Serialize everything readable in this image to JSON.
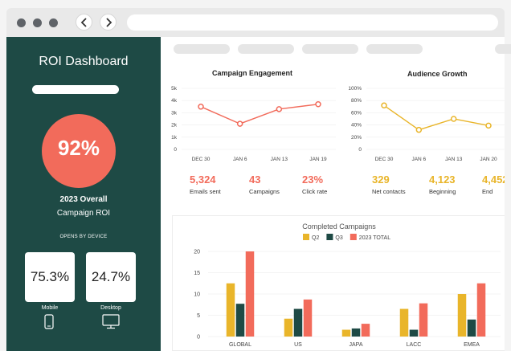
{
  "sidebar": {
    "title": "ROI Dashboard",
    "roi_value": "92%",
    "overall_label": "2023 Overall",
    "campaign_label": "Campaign ROI",
    "opens_label": "OPENS BY DEVICE",
    "devices": [
      {
        "value": "75.3%",
        "label": "Mobile",
        "icon": "mobile-icon"
      },
      {
        "value": "24.7%",
        "label": "Desktop",
        "icon": "desktop-icon"
      }
    ],
    "accent": "#f26b5b",
    "background": "#1e4a45"
  },
  "engagement": {
    "title": "Campaign Engagement",
    "kpis": [
      {
        "value": "5,324",
        "label": "Emails sent"
      },
      {
        "value": "43",
        "label": "Campaigns"
      },
      {
        "value": "23%",
        "label": "Click rate"
      }
    ],
    "color": "#f26b5b"
  },
  "audience": {
    "title": "Audience Growth",
    "kpis": [
      {
        "value": "329",
        "label": "Net contacts"
      },
      {
        "value": "4,123",
        "label": "Beginning"
      },
      {
        "value": "4,452",
        "label": "End"
      }
    ],
    "color": "#e9b52a"
  },
  "completed": {
    "title": "Completed Campaigns"
  },
  "chart_data": [
    {
      "type": "line",
      "title": "Campaign Engagement",
      "x": [
        "DEC 30",
        "JAN 6",
        "JAN 13",
        "JAN 19"
      ],
      "y_ticks": [
        "0",
        "1k",
        "2k",
        "3k",
        "4k",
        "5k"
      ],
      "ylim": [
        0,
        5000
      ],
      "series": [
        {
          "values": [
            3500,
            2100,
            3300,
            3700
          ],
          "color": "#f26b5b"
        }
      ]
    },
    {
      "type": "line",
      "title": "Audience Growth",
      "x": [
        "DEC 30",
        "JAN 6",
        "JAN 13",
        "JAN 20"
      ],
      "y_ticks": [
        "0",
        "20%",
        "40%",
        "60%",
        "80%",
        "100%"
      ],
      "ylim": [
        0,
        100
      ],
      "series": [
        {
          "values": [
            72,
            32,
            50,
            39
          ],
          "color": "#e9b52a"
        }
      ]
    },
    {
      "type": "bar",
      "title": "Completed Campaigns",
      "categories": [
        "GLOBAL",
        "US",
        "JAPA",
        "LACC",
        "EMEA"
      ],
      "y_ticks": [
        "0",
        "5",
        "10",
        "15",
        "20"
      ],
      "ylim": [
        0,
        20
      ],
      "legend_position": "top",
      "series": [
        {
          "name": "Q2",
          "values": [
            12.5,
            4.2,
            1.6,
            6.5,
            10
          ],
          "color": "#e9b52a"
        },
        {
          "name": "Q3",
          "values": [
            7.7,
            6.5,
            1.9,
            1.6,
            4
          ],
          "color": "#1e4a45"
        },
        {
          "name": "2023 TOTAL",
          "values": [
            20,
            8.7,
            3,
            7.8,
            12.5
          ],
          "color": "#f26b5b"
        }
      ]
    }
  ]
}
